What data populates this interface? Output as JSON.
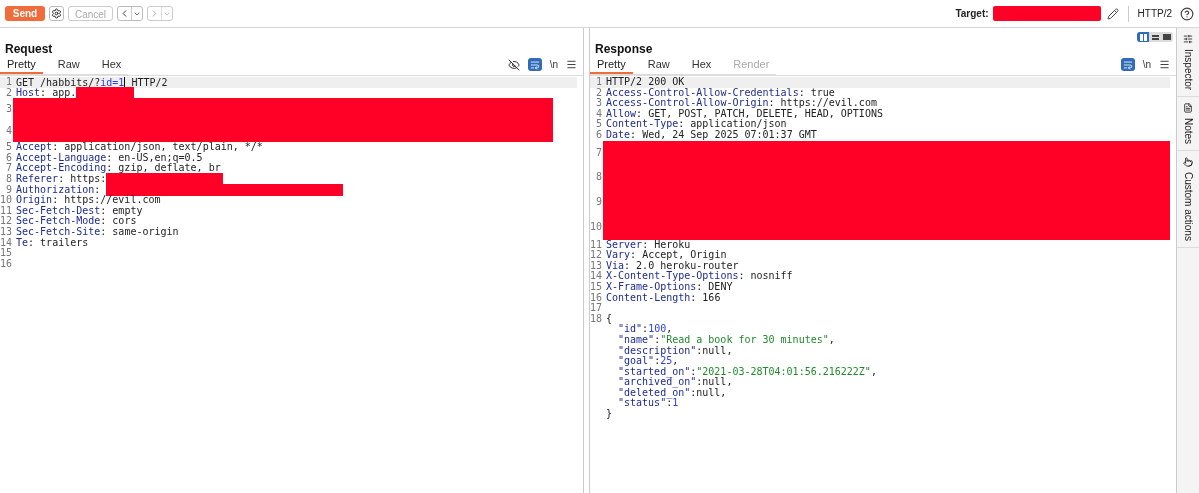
{
  "toolbar": {
    "send": "Send",
    "cancel": {
      "label": "Cancel",
      "disabled": true
    },
    "back": {
      "disabled": false
    },
    "forward": {
      "disabled": true
    },
    "target_label": "Target:",
    "target_redacted": true,
    "protocol": "HTTP/2"
  },
  "layout_toggle": [
    {
      "kind": "columns",
      "selected": true
    },
    {
      "kind": "rows",
      "selected": false
    },
    {
      "kind": "single",
      "selected": false
    }
  ],
  "request": {
    "title": "Request",
    "tabs": [
      {
        "label": "Pretty",
        "selected": true,
        "disabled": false
      },
      {
        "label": "Raw",
        "selected": false,
        "disabled": false
      },
      {
        "label": "Hex",
        "selected": false,
        "disabled": false
      }
    ],
    "hide_toggle": true,
    "wrap_on": true,
    "newline": "\\n",
    "lines": [
      {
        "kind": "line",
        "number": "1",
        "current": true,
        "segments": [
          {
            "kind": "plain",
            "text": "GET /habbits/?"
          },
          {
            "kind": "param",
            "text": "id=1"
          },
          {
            "kind": "cursor"
          },
          {
            "kind": "plain",
            "text": " HTTP/2"
          }
        ]
      },
      {
        "kind": "line",
        "number": "2",
        "current": false,
        "segments": [
          {
            "kind": "key",
            "text": "Host"
          },
          {
            "kind": "plain",
            "text": ": app."
          },
          {
            "kind": "redaction"
          }
        ]
      },
      {
        "kind": "block",
        "numbers": [
          "3",
          "4"
        ]
      },
      {
        "kind": "line",
        "number": "5",
        "current": false,
        "segments": [
          {
            "kind": "key",
            "text": "Accept"
          },
          {
            "kind": "plain",
            "text": ": application/json, text/plain, */*"
          }
        ]
      },
      {
        "kind": "line",
        "number": "6",
        "current": false,
        "segments": [
          {
            "kind": "key",
            "text": "Accept-Language"
          },
          {
            "kind": "plain",
            "text": ": en-US,en;q=0.5"
          }
        ]
      },
      {
        "kind": "line",
        "number": "7",
        "current": false,
        "segments": [
          {
            "kind": "key",
            "text": "Accept-Encoding"
          },
          {
            "kind": "plain",
            "text": ": gzip, deflate, br"
          }
        ]
      },
      {
        "kind": "line",
        "number": "8",
        "current": false,
        "segments": [
          {
            "kind": "key",
            "text": "Referer"
          },
          {
            "kind": "plain",
            "text": ": https:"
          },
          {
            "kind": "redaction"
          }
        ]
      },
      {
        "kind": "line",
        "number": "9",
        "current": false,
        "segments": [
          {
            "kind": "key",
            "text": "Authorization"
          },
          {
            "kind": "plain",
            "text": ": "
          },
          {
            "kind": "redaction"
          }
        ]
      },
      {
        "kind": "line",
        "number": "10",
        "current": false,
        "segments": [
          {
            "kind": "key",
            "text": "Origin"
          },
          {
            "kind": "plain",
            "text": ": https://evil.com"
          }
        ]
      },
      {
        "kind": "line",
        "number": "11",
        "current": false,
        "segments": [
          {
            "kind": "key",
            "text": "Sec-Fetch-Dest"
          },
          {
            "kind": "plain",
            "text": ": empty"
          }
        ]
      },
      {
        "kind": "line",
        "number": "12",
        "current": false,
        "segments": [
          {
            "kind": "key",
            "text": "Sec-Fetch-Mode"
          },
          {
            "kind": "plain",
            "text": ": cors"
          }
        ]
      },
      {
        "kind": "line",
        "number": "13",
        "current": false,
        "segments": [
          {
            "kind": "key",
            "text": "Sec-Fetch-Site"
          },
          {
            "kind": "plain",
            "text": ": same-origin"
          }
        ]
      },
      {
        "kind": "line",
        "number": "14",
        "current": false,
        "segments": [
          {
            "kind": "key",
            "text": "Te"
          },
          {
            "kind": "plain",
            "text": ": trailers"
          }
        ]
      },
      {
        "kind": "line",
        "number": "15",
        "current": false
      },
      {
        "kind": "line",
        "number": "16",
        "current": false
      }
    ]
  },
  "response": {
    "title": "Response",
    "tabs": [
      {
        "label": "Pretty",
        "selected": true,
        "disabled": false
      },
      {
        "label": "Raw",
        "selected": false,
        "disabled": false
      },
      {
        "label": "Hex",
        "selected": false,
        "disabled": false
      },
      {
        "label": "Render",
        "selected": false,
        "disabled": true
      }
    ],
    "wrap_on": true,
    "newline": "\\n",
    "lines": [
      {
        "kind": "line",
        "number": "1",
        "current": true,
        "segments": [
          {
            "kind": "plain",
            "text": "HTTP/2 200 OK"
          }
        ]
      },
      {
        "kind": "line",
        "number": "2",
        "current": false,
        "segments": [
          {
            "kind": "key",
            "text": "Access-Control-Allow-Credentials"
          },
          {
            "kind": "plain",
            "text": ": true"
          }
        ]
      },
      {
        "kind": "line",
        "number": "3",
        "current": false,
        "segments": [
          {
            "kind": "key",
            "text": "Access-Control-Allow-Origin"
          },
          {
            "kind": "plain",
            "text": ": https://evil.com"
          }
        ]
      },
      {
        "kind": "line",
        "number": "4",
        "current": false,
        "segments": [
          {
            "kind": "key",
            "text": "Allow"
          },
          {
            "kind": "plain",
            "text": ": GET, POST, PATCH, DELETE, HEAD, OPTIONS"
          }
        ]
      },
      {
        "kind": "line",
        "number": "5",
        "current": false,
        "segments": [
          {
            "kind": "key",
            "text": "Content-Type"
          },
          {
            "kind": "plain",
            "text": ": application/json"
          }
        ]
      },
      {
        "kind": "line",
        "number": "6",
        "current": false,
        "segments": [
          {
            "kind": "key",
            "text": "Date"
          },
          {
            "kind": "plain",
            "text": ": Wed, 24 Sep 2025 07:01:37 GMT"
          }
        ]
      },
      {
        "kind": "block",
        "numbers": [
          "7",
          "8",
          "9",
          "10"
        ]
      },
      {
        "kind": "line",
        "number": "11",
        "current": false,
        "segments": [
          {
            "kind": "key",
            "text": "Server"
          },
          {
            "kind": "plain",
            "text": ": Heroku"
          }
        ]
      },
      {
        "kind": "line",
        "number": "12",
        "current": false,
        "segments": [
          {
            "kind": "key",
            "text": "Vary"
          },
          {
            "kind": "plain",
            "text": ": Accept, Origin"
          }
        ]
      },
      {
        "kind": "line",
        "number": "13",
        "current": false,
        "segments": [
          {
            "kind": "key",
            "text": "Via"
          },
          {
            "kind": "plain",
            "text": ": 2.0 heroku-router"
          }
        ]
      },
      {
        "kind": "line",
        "number": "14",
        "current": false,
        "segments": [
          {
            "kind": "key",
            "text": "X-Content-Type-Options"
          },
          {
            "kind": "plain",
            "text": ": nosniff"
          }
        ]
      },
      {
        "kind": "line",
        "number": "15",
        "current": false,
        "segments": [
          {
            "kind": "key",
            "text": "X-Frame-Options"
          },
          {
            "kind": "plain",
            "text": ": DENY"
          }
        ]
      },
      {
        "kind": "line",
        "number": "16",
        "current": false,
        "segments": [
          {
            "kind": "key",
            "text": "Content-Length"
          },
          {
            "kind": "plain",
            "text": ": 166"
          }
        ]
      },
      {
        "kind": "line",
        "number": "17",
        "current": false
      },
      {
        "kind": "line",
        "number": "18",
        "current": false,
        "segments": [
          {
            "kind": "plain",
            "text": "{"
          }
        ]
      },
      {
        "kind": "member",
        "segments": [
          {
            "kind": "key",
            "text": "\"id\""
          },
          {
            "kind": "plain",
            "text": ":"
          },
          {
            "kind": "number",
            "text": "100"
          },
          {
            "kind": "plain",
            "text": ","
          }
        ]
      },
      {
        "kind": "member",
        "segments": [
          {
            "kind": "key",
            "text": "\"name\""
          },
          {
            "kind": "plain",
            "text": ":"
          },
          {
            "kind": "string",
            "text": "\"Read a book for 30 minutes\""
          },
          {
            "kind": "plain",
            "text": ","
          }
        ]
      },
      {
        "kind": "member",
        "segments": [
          {
            "kind": "key",
            "text": "\"description\""
          },
          {
            "kind": "plain",
            "text": ":null,"
          }
        ]
      },
      {
        "kind": "member",
        "segments": [
          {
            "kind": "key",
            "text": "\"goal\""
          },
          {
            "kind": "plain",
            "text": ":"
          },
          {
            "kind": "number",
            "text": "25"
          },
          {
            "kind": "plain",
            "text": ","
          }
        ]
      },
      {
        "kind": "member",
        "segments": [
          {
            "kind": "key",
            "text": "\"started_on\""
          },
          {
            "kind": "plain",
            "text": ":"
          },
          {
            "kind": "string",
            "text": "\"2021-03-28T04:01:56.216222Z\""
          },
          {
            "kind": "plain",
            "text": ","
          }
        ]
      },
      {
        "kind": "member",
        "segments": [
          {
            "kind": "key",
            "text": "\"archived_on\""
          },
          {
            "kind": "plain",
            "text": ":null,"
          }
        ]
      },
      {
        "kind": "member",
        "segments": [
          {
            "kind": "key",
            "text": "\"deleted_on\""
          },
          {
            "kind": "plain",
            "text": ":null,"
          }
        ]
      },
      {
        "kind": "member",
        "segments": [
          {
            "kind": "key",
            "text": "\"status\""
          },
          {
            "kind": "plain",
            "text": ":"
          },
          {
            "kind": "number",
            "text": "1"
          }
        ]
      },
      {
        "kind": "brace",
        "segments": [
          {
            "kind": "plain",
            "text": "}"
          }
        ]
      }
    ]
  },
  "sidebar": [
    {
      "kind": "inspector",
      "label": "Inspector"
    },
    {
      "kind": "notes",
      "label": "Notes"
    },
    {
      "kind": "actions",
      "label": "Custom actions"
    }
  ]
}
